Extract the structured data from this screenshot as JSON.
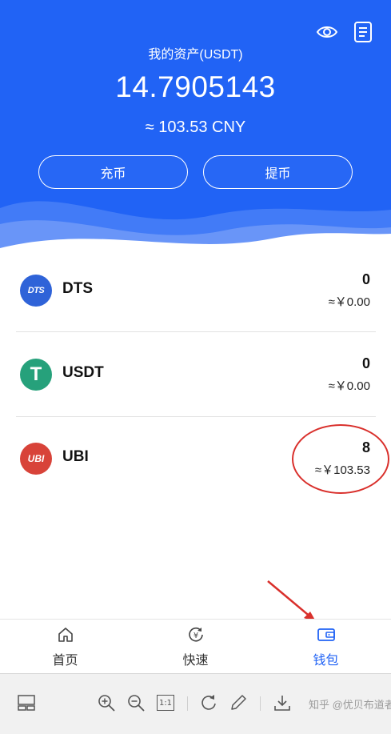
{
  "header": {
    "title": "我的资产(USDT)",
    "total_amount": "14.7905143",
    "cny_equivalent": "≈ 103.53 CNY",
    "deposit_label": "充币",
    "withdraw_label": "提币",
    "icons": [
      "eye-icon",
      "document-icon"
    ]
  },
  "assets": [
    {
      "logo_text": "DTS",
      "symbol": "DTS",
      "quantity": "0",
      "value": "≈￥0.00",
      "logo_color": "#2f63d8"
    },
    {
      "logo_text": "T",
      "symbol": "USDT",
      "quantity": "0",
      "value": "≈￥0.00",
      "logo_color": "#26a17b"
    },
    {
      "logo_text": "UBI",
      "symbol": "UBI",
      "quantity": "8",
      "value": "≈￥103.53",
      "logo_color": "#d84339"
    }
  ],
  "tabbar": {
    "tabs": [
      {
        "label": "首页",
        "icon": "home-icon"
      },
      {
        "label": "快速",
        "icon": "yuan-exchange-icon"
      },
      {
        "label": "钱包",
        "icon": "wallet-icon",
        "active": true
      }
    ]
  },
  "viewer_toolbar": {
    "icons": [
      "thumbnail-icon",
      "zoom-in-icon",
      "zoom-out-icon",
      "actual-size-icon",
      "rotate-icon",
      "edit-icon",
      "download-icon"
    ],
    "actual_size_label": "1:1",
    "watermark": "知乎 @优贝布道者"
  },
  "colors": {
    "primary": "#2163f5",
    "annotation": "#d9302c",
    "wave_light": "#5f90f7"
  }
}
